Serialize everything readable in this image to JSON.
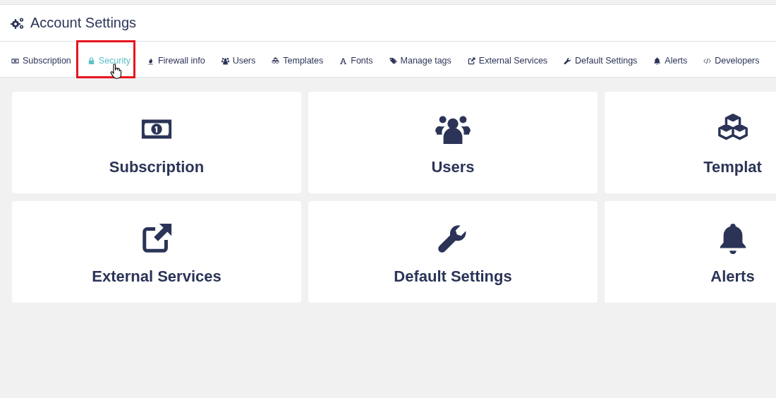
{
  "header": {
    "title": "Account Settings"
  },
  "nav": [
    {
      "label": "Subscription",
      "selected": false,
      "annotated": false,
      "pointer": false
    },
    {
      "label": "Security",
      "selected": true,
      "annotated": true,
      "pointer": true
    },
    {
      "label": "Firewall info",
      "selected": false,
      "annotated": false,
      "pointer": false
    },
    {
      "label": "Users",
      "selected": false,
      "annotated": false,
      "pointer": false
    },
    {
      "label": "Templates",
      "selected": false,
      "annotated": false,
      "pointer": false
    },
    {
      "label": "Fonts",
      "selected": false,
      "annotated": false,
      "pointer": false
    },
    {
      "label": "Manage tags",
      "selected": false,
      "annotated": false,
      "pointer": false
    },
    {
      "label": "External Services",
      "selected": false,
      "annotated": false,
      "pointer": false
    },
    {
      "label": "Default Settings",
      "selected": false,
      "annotated": false,
      "pointer": false
    },
    {
      "label": "Alerts",
      "selected": false,
      "annotated": false,
      "pointer": false
    },
    {
      "label": "Developers",
      "selected": false,
      "annotated": false,
      "pointer": false
    }
  ],
  "cards": [
    {
      "label": "Subscription"
    },
    {
      "label": "Users"
    },
    {
      "label": "Templat"
    },
    {
      "label": "External Services"
    },
    {
      "label": "Default Settings"
    },
    {
      "label": "Alerts"
    }
  ]
}
